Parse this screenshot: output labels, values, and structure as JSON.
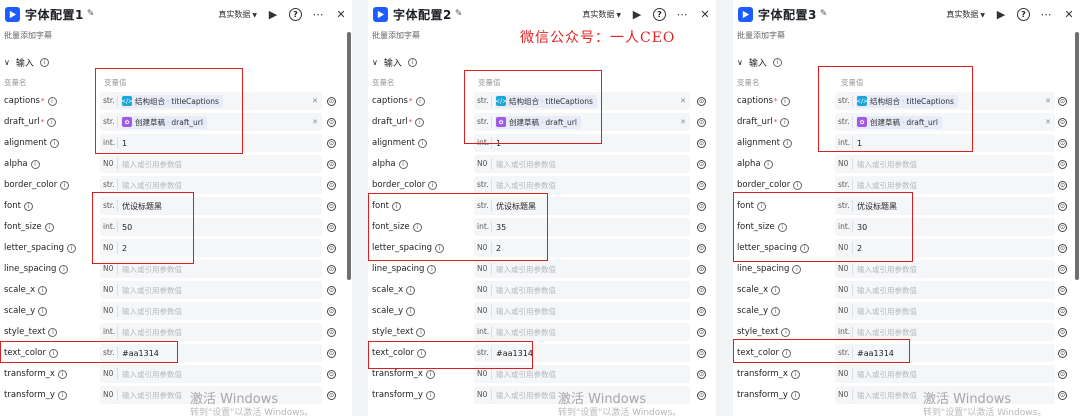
{
  "panels": [
    {
      "title": "字体配置1",
      "mode": "真实数据",
      "subtitle": "批量添加字幕",
      "section": "输入",
      "col_name": "变量名",
      "col_value": "变量值",
      "rows": [
        {
          "name": "captions",
          "required": true,
          "type": "str.",
          "chip_icon": "</>",
          "chip_src": "结构组合",
          "chip_field": "titleCaptions"
        },
        {
          "name": "draft_url",
          "required": true,
          "type": "str.",
          "chip_icon": "✿",
          "chip_src": "创建草稿",
          "chip_field": "draft_url"
        },
        {
          "name": "alignment",
          "type": "int.",
          "value": "1"
        },
        {
          "name": "alpha",
          "type": "N0",
          "placeholder": "输入或引用参数值"
        },
        {
          "name": "border_color",
          "type": "str.",
          "placeholder": "输入或引用参数值"
        },
        {
          "name": "font",
          "type": "str.",
          "value": "优设标题黑"
        },
        {
          "name": "font_size",
          "type": "int.",
          "value": "50"
        },
        {
          "name": "letter_spacing",
          "type": "N0",
          "value": "2"
        },
        {
          "name": "line_spacing",
          "type": "N0",
          "placeholder": "输入或引用参数值"
        },
        {
          "name": "scale_x",
          "type": "N0",
          "placeholder": "输入或引用参数值"
        },
        {
          "name": "scale_y",
          "type": "N0",
          "placeholder": "输入或引用参数值"
        },
        {
          "name": "style_text",
          "type": "int.",
          "placeholder": "输入或引用参数值"
        },
        {
          "name": "text_color",
          "type": "str.",
          "value": "#aa1314"
        },
        {
          "name": "transform_x",
          "type": "N0",
          "placeholder": "输入或引用参数值"
        },
        {
          "name": "transform_y",
          "type": "N0",
          "placeholder": "输入或引用参数值"
        }
      ],
      "watermark_1": "激活 Windows",
      "watermark_2": "转到\"设置\"以激活 Windows。"
    },
    {
      "title": "字体配置2",
      "mode": "真实数据",
      "subtitle": "批量添加字幕",
      "section": "输入",
      "col_name": "变量名",
      "col_value": "变量值",
      "rows": [
        {
          "name": "captions",
          "required": true,
          "type": "str.",
          "chip_icon": "</>",
          "chip_src": "结构组合",
          "chip_field": "titleCaptions"
        },
        {
          "name": "draft_url",
          "required": true,
          "type": "str.",
          "chip_icon": "✿",
          "chip_src": "创建草稿",
          "chip_field": "draft_url"
        },
        {
          "name": "alignment",
          "type": "int.",
          "value": "1"
        },
        {
          "name": "alpha",
          "type": "N0",
          "placeholder": "输入或引用参数值"
        },
        {
          "name": "border_color",
          "type": "str.",
          "placeholder": "输入或引用参数值"
        },
        {
          "name": "font",
          "type": "str.",
          "value": "优设标题黑"
        },
        {
          "name": "font_size",
          "type": "int.",
          "value": "35"
        },
        {
          "name": "letter_spacing",
          "type": "N0",
          "value": "2"
        },
        {
          "name": "line_spacing",
          "type": "N0",
          "placeholder": "输入或引用参数值"
        },
        {
          "name": "scale_x",
          "type": "N0",
          "placeholder": "输入或引用参数值"
        },
        {
          "name": "scale_y",
          "type": "N0",
          "placeholder": "输入或引用参数值"
        },
        {
          "name": "style_text",
          "type": "int.",
          "placeholder": "输入或引用参数值"
        },
        {
          "name": "text_color",
          "type": "str.",
          "value": "#aa1314"
        },
        {
          "name": "transform_x",
          "type": "N0",
          "placeholder": "输入或引用参数值"
        },
        {
          "name": "transform_y",
          "type": "N0",
          "placeholder": "输入或引用参数值"
        }
      ],
      "watermark_1": "激活 Windows",
      "watermark_2": "转到\"设置\"以激活 Windows。"
    },
    {
      "title": "字体配置3",
      "mode": "真实数据",
      "subtitle": "批量添加字幕",
      "section": "输入",
      "col_name": "变量名",
      "col_value": "变量值",
      "rows": [
        {
          "name": "captions",
          "required": true,
          "type": "str.",
          "chip_icon": "</>",
          "chip_src": "结构组合",
          "chip_field": "titleCaptions"
        },
        {
          "name": "draft_url",
          "required": true,
          "type": "str.",
          "chip_icon": "✿",
          "chip_src": "创建草稿",
          "chip_field": "draft_url"
        },
        {
          "name": "alignment",
          "type": "int.",
          "value": "1"
        },
        {
          "name": "alpha",
          "type": "N0",
          "placeholder": "输入或引用参数值"
        },
        {
          "name": "border_color",
          "type": "str.",
          "placeholder": "输入或引用参数值"
        },
        {
          "name": "font",
          "type": "str.",
          "value": "优设标题黑"
        },
        {
          "name": "font_size",
          "type": "int.",
          "value": "30"
        },
        {
          "name": "letter_spacing",
          "type": "N0",
          "value": "2"
        },
        {
          "name": "line_spacing",
          "type": "N0",
          "placeholder": "输入或引用参数值"
        },
        {
          "name": "scale_x",
          "type": "N0",
          "placeholder": "输入或引用参数值"
        },
        {
          "name": "scale_y",
          "type": "N0",
          "placeholder": "输入或引用参数值"
        },
        {
          "name": "style_text",
          "type": "int.",
          "placeholder": "输入或引用参数值"
        },
        {
          "name": "text_color",
          "type": "str.",
          "value": "#aa1314"
        },
        {
          "name": "transform_x",
          "type": "N0",
          "placeholder": "输入或引用参数值"
        },
        {
          "name": "transform_y",
          "type": "N0",
          "placeholder": "输入或引用参数值"
        }
      ],
      "watermark_1": "激活 Windows",
      "watermark_2": "转到\"设置\"以激活 Windows。"
    }
  ],
  "overlay_title": "微信公众号：一人CEO",
  "colors": {
    "accent": "#1d5dff",
    "highlight_box": "#d92020",
    "overlay_title": "#e02424",
    "chip_bg": "#e8ecf9",
    "chip_struct_icon": "#1aa7d8",
    "chip_draft_icon": "#a05ae8",
    "input_bg": "#f5f6f8",
    "gutter": "#f2f3f5"
  },
  "icons": {
    "app": "play-logo-icon",
    "edit": "edit-icon",
    "mode_caret": "caret-down-icon",
    "run": "play-icon",
    "help": "help-circle-icon",
    "more": "more-icon",
    "close": "close-icon",
    "info": "info-icon",
    "ref": "reference-icon",
    "clear": "clear-icon"
  }
}
